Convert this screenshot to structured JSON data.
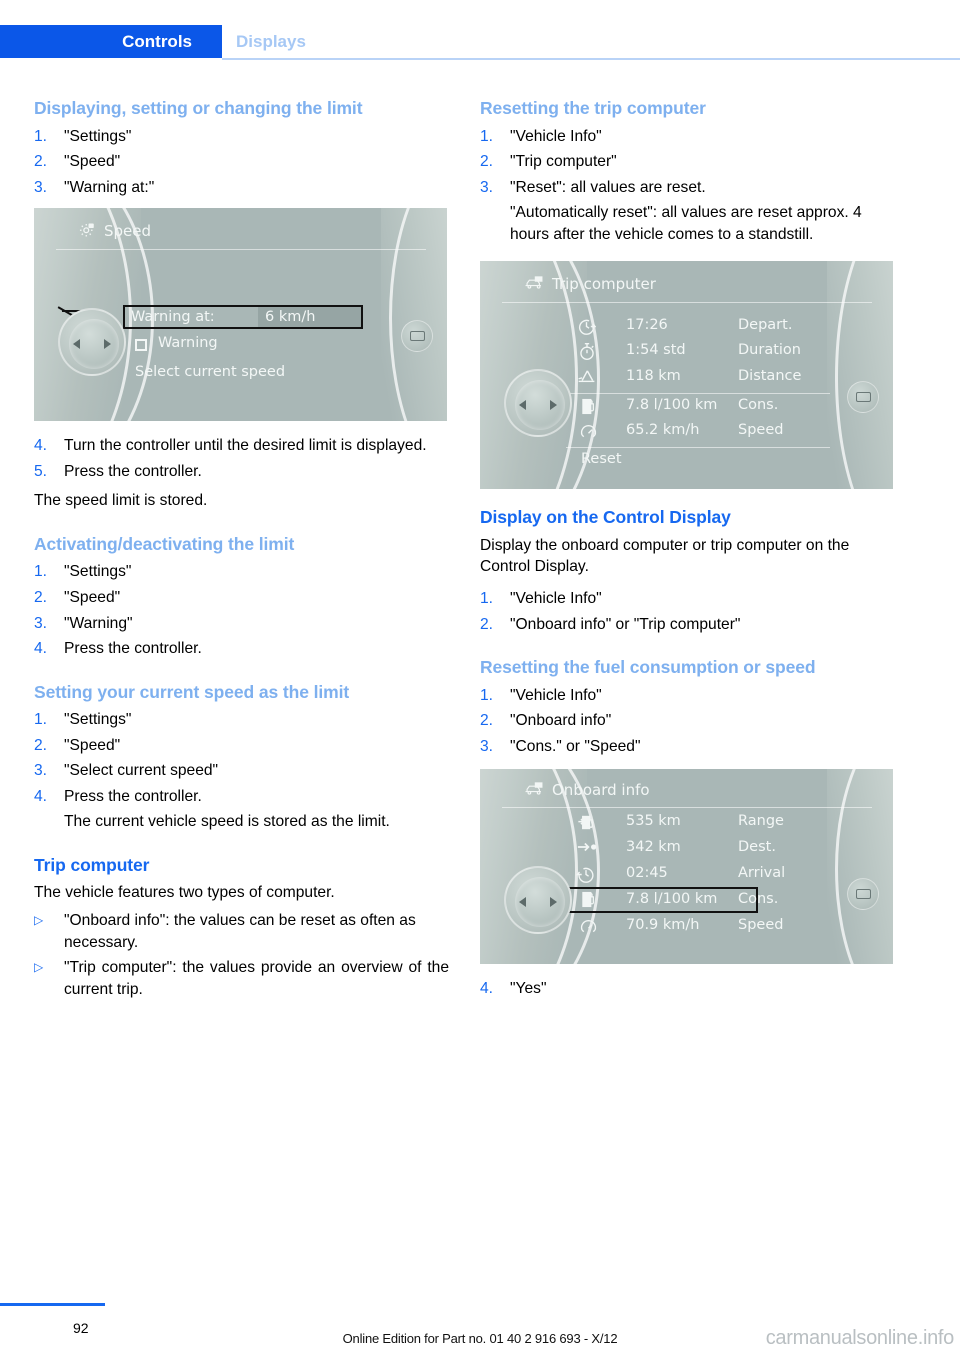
{
  "header": {
    "tab_active": "Controls",
    "tab_inactive": "Displays"
  },
  "left_column": {
    "heading_1": "Displaying, setting or changing the limit",
    "steps_1": [
      {
        "num": "1.",
        "text": "\"Settings\""
      },
      {
        "num": "2.",
        "text": "\"Speed\""
      },
      {
        "num": "3.",
        "text": "\"Warning at:\""
      }
    ],
    "steps_2": [
      {
        "num": "4.",
        "text": "Turn the controller until the desired limit is displayed."
      },
      {
        "num": "5.",
        "text": "Press the controller."
      }
    ],
    "note_1": "The speed limit is stored.",
    "heading_2": "Activating/deactivating the limit",
    "steps_3": [
      {
        "num": "1.",
        "text": "\"Settings\""
      },
      {
        "num": "2.",
        "text": "\"Speed\""
      },
      {
        "num": "3.",
        "text": "\"Warning\""
      },
      {
        "num": "4.",
        "text": "Press the controller."
      }
    ],
    "heading_3": "Setting your current speed as the limit",
    "steps_4": [
      {
        "num": "1.",
        "text": "\"Settings\""
      },
      {
        "num": "2.",
        "text": "\"Speed\""
      },
      {
        "num": "3.",
        "text": "\"Select current speed\""
      },
      {
        "num": "4.",
        "text": "Press the controller."
      }
    ],
    "sub_note_1": "The current vehicle speed is stored as the limit.",
    "heading_4": "Trip computer",
    "note_2": "The vehicle features two types of computer.",
    "bullets": [
      {
        "mark": "▷",
        "text": "\"Onboard info\": the values can be reset as often as necessary."
      },
      {
        "mark": "▷",
        "text": "\"Trip computer\": the values provide an overview of the current trip."
      }
    ]
  },
  "right_column": {
    "heading_1": "Resetting the trip computer",
    "steps_1": [
      {
        "num": "1.",
        "text": "\"Vehicle Info\""
      },
      {
        "num": "2.",
        "text": "\"Trip computer\""
      },
      {
        "num": "3.",
        "text": "\"Reset\": all values are reset."
      }
    ],
    "sub_note_1": "\"Automatically reset\": all values are reset approx. 4 hours after the vehicle comes to a standstill.",
    "heading_2": "Display on the Control Display",
    "note_1": "Display the onboard computer or trip computer on the Control Display.",
    "steps_2": [
      {
        "num": "1.",
        "text": "\"Vehicle Info\""
      },
      {
        "num": "2.",
        "text": "\"Onboard info\" or \"Trip computer\""
      }
    ],
    "heading_3": "Resetting the fuel consumption or speed",
    "steps_3": [
      {
        "num": "1.",
        "text": "\"Vehicle Info\""
      },
      {
        "num": "2.",
        "text": "\"Onboard info\""
      },
      {
        "num": "3.",
        "text": "\"Cons.\" or \"Speed\""
      }
    ],
    "steps_4": [
      {
        "num": "4.",
        "text": "\"Yes\""
      }
    ]
  },
  "figure_speed": {
    "title": "Speed",
    "title_icon": "settings-gear-icon",
    "selected_label": "Warning at:",
    "selected_value": "6 km/h",
    "checkbox_label": "Warning",
    "option_label": "Select current speed"
  },
  "figure_trip_computer": {
    "title": "Trip computer",
    "title_icon": "vehicle-info-icon",
    "rows": [
      {
        "icon": "departure-clock-icon",
        "value": "17:26",
        "label": "Depart."
      },
      {
        "icon": "stopwatch-icon",
        "value": "1:54 std",
        "label": "Duration"
      },
      {
        "icon": "distance-road-icon",
        "value": "118 km",
        "label": "Distance"
      },
      {
        "icon": "fuel-pump-icon",
        "value": "7.8 l/100 km",
        "label": "Cons."
      },
      {
        "icon": "speedometer-icon",
        "value": "65.2 km/h",
        "label": "Speed"
      }
    ],
    "reset_label": "Reset"
  },
  "figure_onboard_info": {
    "title": "Onboard info",
    "title_icon": "vehicle-info-icon",
    "rows": [
      {
        "icon": "range-fuel-icon",
        "value": "535 km",
        "label": "Range",
        "selected": false
      },
      {
        "icon": "destination-arrow-icon",
        "value": "342 km",
        "label": "Dest.",
        "selected": false
      },
      {
        "icon": "arrival-clock-icon",
        "value": "02:45",
        "label": "Arrival",
        "selected": false
      },
      {
        "icon": "fuel-pump-icon",
        "value": "7.8 l/100 km",
        "label": "Cons.",
        "selected": true
      },
      {
        "icon": "speedometer-icon",
        "value": "70.9 km/h",
        "label": "Speed",
        "selected": false
      }
    ]
  },
  "footer": {
    "page_number": "92",
    "note": "Online Edition for Part no. 01 40 2 916 693 - X/12",
    "watermark": "carmanualsonline.info"
  },
  "colors": {
    "brand_blue": "#1668f0",
    "tab_blue": "#0b57e8",
    "heading_light_blue": "#7eb0ef",
    "screen_bg": "#a9b7b6"
  }
}
